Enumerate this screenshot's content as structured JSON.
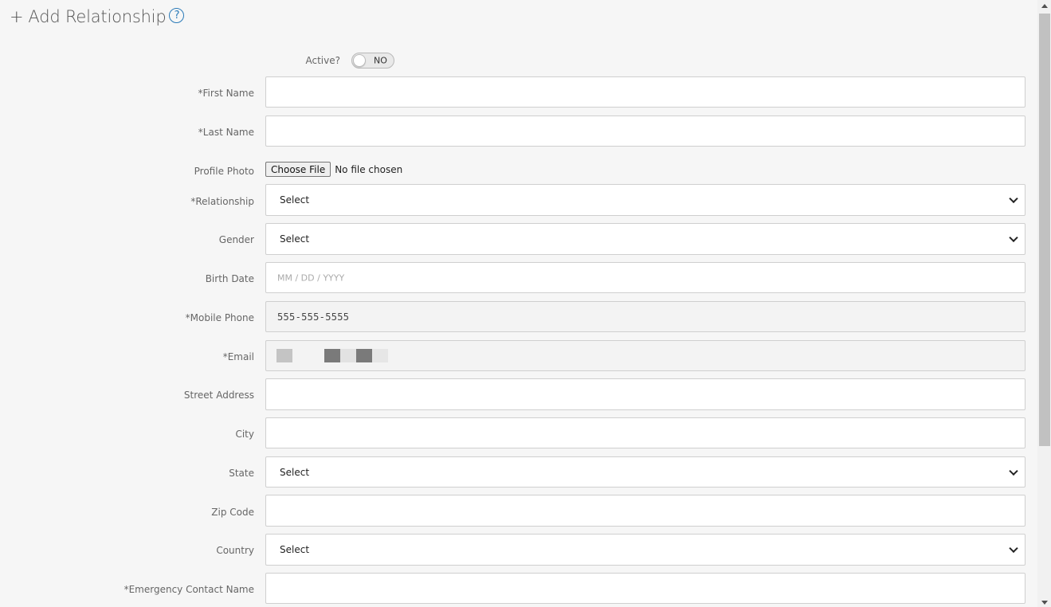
{
  "header": {
    "plus": "+",
    "title": "Add Relationship",
    "help_icon": "?"
  },
  "active": {
    "label": "Active?",
    "toggle_text": "NO"
  },
  "fields": {
    "first_name": {
      "label": "*First Name",
      "value": ""
    },
    "last_name": {
      "label": "*Last Name",
      "value": ""
    },
    "profile_photo": {
      "label": "Profile Photo",
      "button": "Choose File",
      "status": "No file chosen"
    },
    "relationship": {
      "label": "*Relationship",
      "selected": "Select"
    },
    "gender": {
      "label": "Gender",
      "selected": "Select"
    },
    "birth_date": {
      "label": "Birth Date",
      "placeholder": "MM / DD / YYYY"
    },
    "mobile_phone": {
      "label": "*Mobile Phone",
      "value": "555-555-5555"
    },
    "email": {
      "label": "*Email",
      "value": ""
    },
    "street_address": {
      "label": "Street Address",
      "value": ""
    },
    "city": {
      "label": "City",
      "value": ""
    },
    "state": {
      "label": "State",
      "selected": "Select"
    },
    "zip_code": {
      "label": "Zip Code",
      "value": ""
    },
    "country": {
      "label": "Country",
      "selected": "Select"
    },
    "emergency_contact_name": {
      "label": "*Emergency Contact Name",
      "value": ""
    }
  },
  "colors": {
    "accent": "#2a7ab8",
    "background": "#f6f6f6",
    "border": "#cfcfcf"
  }
}
